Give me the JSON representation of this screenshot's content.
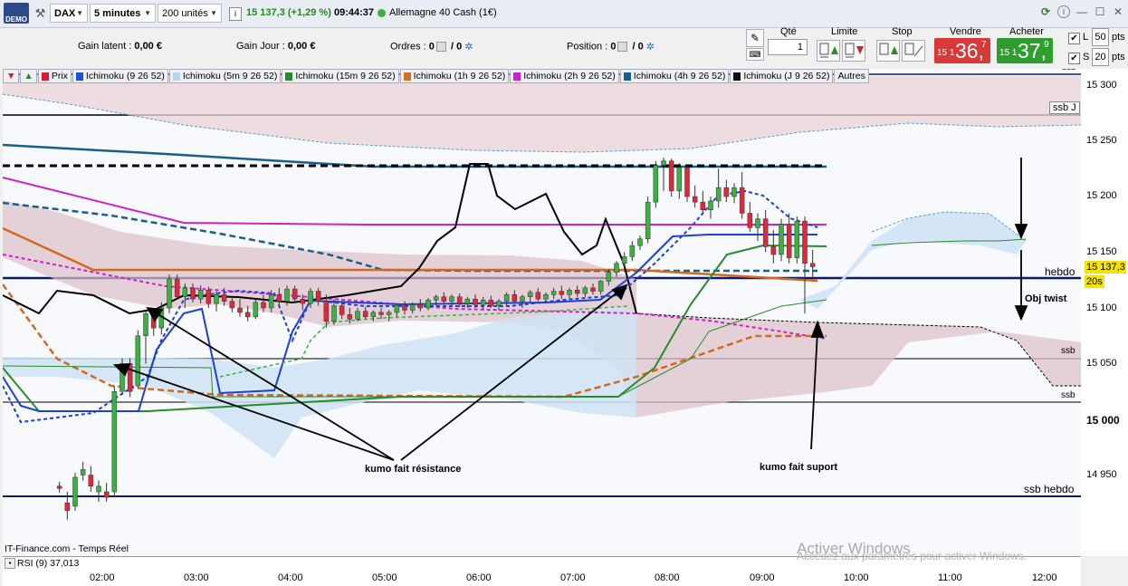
{
  "toolbar": {
    "demo_label": "DEMO",
    "symbol": "DAX",
    "timeframe": "5 minutes",
    "units": "200 unités",
    "price_change": "15 137,3 (+1,29 %)",
    "time": "09:44:37",
    "instrument": "Allemagne 40 Cash (1€)"
  },
  "summary": {
    "gain_latent_label": "Gain latent :",
    "gain_latent_value": "0,00 €",
    "gain_jour_label": "Gain Jour :",
    "gain_jour_value": "0,00 €",
    "ordres_label": "Ordres :",
    "ordres_value": "0",
    "ordres_total": "/ 0",
    "position_label": "Position :",
    "position_value": "0",
    "position_total": "/ 0"
  },
  "order": {
    "qty_label": "Qté",
    "qty_value": "1",
    "limit_label": "Limite",
    "stop_label": "Stop",
    "sell_label": "Vendre",
    "buy_label": "Acheter",
    "sell_small": "15 1",
    "sell_big": "36,",
    "sell_sup": "7",
    "buy_small": "15 1",
    "buy_big": "37,",
    "buy_sup": "9",
    "l_label": "L",
    "l_value": "50",
    "s_label": "S",
    "s_value": "20",
    "pts": "pts"
  },
  "indicators": [
    {
      "label": "Prix",
      "color": "#d81b35"
    },
    {
      "label": "Ichimoku (9 26 52)",
      "color": "#2050d0"
    },
    {
      "label": "Ichimoku (5m 9 26 52)",
      "color": "#b8d4ec"
    },
    {
      "label": "Ichimoku (15m 9 26 52)",
      "color": "#2a8a2a"
    },
    {
      "label": "Ichimoku (1h 9 26 52)",
      "color": "#d07020"
    },
    {
      "label": "Ichimoku (2h 9 26 52)",
      "color": "#cc22cc"
    },
    {
      "label": "Ichimoku (4h 9 26 52)",
      "color": "#1a5e8c"
    },
    {
      "label": "Ichimoku (J 9 26 52)",
      "color": "#111111"
    }
  ],
  "indicators_more": "Autres",
  "y_axis": [
    "15 300",
    "15 250",
    "15 200",
    "15 150",
    "15 100",
    "15 050",
    "15 000",
    "14 950"
  ],
  "price_marker": "15 137,3",
  "countdown": "20s",
  "time_axis": [
    "02:00",
    "03:00",
    "04:00",
    "05:00",
    "06:00",
    "07:00",
    "08:00",
    "09:00",
    "10:00",
    "11:00",
    "12:00"
  ],
  "annotations": {
    "ssb_j": "ssb J",
    "ssb_top": "ssb",
    "hebdo": "hebdo",
    "obj_twist": "Obj twist",
    "ssb_1": "ssb",
    "ssb_2": "ssb",
    "ssb_hebdo": "ssb hebdo",
    "resistance": "kumo fait résistance",
    "support": "kumo fait suport"
  },
  "footer": {
    "source": "IT-Finance.com - Temps Réel",
    "rsi": "RSI (9) 37,013",
    "watermark_1": "Activer Windows",
    "watermark_2": "Accédez aux paramètres pour activer Windows."
  },
  "colors": {
    "bull": "#3cb043",
    "bear": "#e0283c",
    "tenkan": "#1f3fd6",
    "ichi_4h": "#1a5e8c",
    "ichi_2h": "#cc22cc",
    "ichi_1h": "#d2691e",
    "ichi_15m": "#2a8a2a",
    "ichi_j": "#000000",
    "hline": "#0a1a70"
  },
  "chart_data": {
    "type": "candlestick",
    "y_range": [
      14900,
      15315
    ],
    "candles": [
      {
        "t": "01:35",
        "o": 14940,
        "h": 14944,
        "l": 14934,
        "c": 14938
      },
      {
        "t": "01:40",
        "o": 14925,
        "h": 14935,
        "l": 14910,
        "c": 14918
      },
      {
        "t": "01:45",
        "o": 14922,
        "h": 14952,
        "l": 14918,
        "c": 14948
      },
      {
        "t": "01:50",
        "o": 14950,
        "h": 14962,
        "l": 14945,
        "c": 14955
      },
      {
        "t": "01:55",
        "o": 14950,
        "h": 14958,
        "l": 14935,
        "c": 14940
      },
      {
        "t": "02:00",
        "o": 14935,
        "h": 14945,
        "l": 14926,
        "c": 14940
      },
      {
        "t": "02:05",
        "o": 14935,
        "h": 14943,
        "l": 14926,
        "c": 14930
      },
      {
        "t": "02:10",
        "o": 14935,
        "h": 15030,
        "l": 14930,
        "c": 15025
      },
      {
        "t": "02:15",
        "o": 15025,
        "h": 15055,
        "l": 15022,
        "c": 15050
      },
      {
        "t": "02:20",
        "o": 15050,
        "h": 15055,
        "l": 15020,
        "c": 15025
      },
      {
        "t": "02:25",
        "o": 15030,
        "h": 15080,
        "l": 15028,
        "c": 15075
      },
      {
        "t": "02:30",
        "o": 15075,
        "h": 15098,
        "l": 15050,
        "c": 15095
      },
      {
        "t": "02:35",
        "o": 15095,
        "h": 15100,
        "l": 15075,
        "c": 15082
      },
      {
        "t": "02:40",
        "o": 15082,
        "h": 15105,
        "l": 15076,
        "c": 15100
      },
      {
        "t": "02:45",
        "o": 15100,
        "h": 15130,
        "l": 15095,
        "c": 15126
      },
      {
        "t": "02:50",
        "o": 15126,
        "h": 15130,
        "l": 15108,
        "c": 15110
      },
      {
        "t": "02:55",
        "o": 15110,
        "h": 15122,
        "l": 15100,
        "c": 15118
      },
      {
        "t": "03:00",
        "o": 15118,
        "h": 15122,
        "l": 15105,
        "c": 15108
      },
      {
        "t": "03:05",
        "o": 15108,
        "h": 15120,
        "l": 15104,
        "c": 15116
      },
      {
        "t": "03:10",
        "o": 15116,
        "h": 15119,
        "l": 15100,
        "c": 15104
      },
      {
        "t": "03:15",
        "o": 15104,
        "h": 15115,
        "l": 15097,
        "c": 15112
      },
      {
        "t": "03:20",
        "o": 15112,
        "h": 15118,
        "l": 15102,
        "c": 15106
      },
      {
        "t": "03:25",
        "o": 15106,
        "h": 15110,
        "l": 15096,
        "c": 15100
      },
      {
        "t": "03:30",
        "o": 15100,
        "h": 15108,
        "l": 15092,
        "c": 15096
      },
      {
        "t": "03:35",
        "o": 15096,
        "h": 15102,
        "l": 15088,
        "c": 15092
      },
      {
        "t": "03:40",
        "o": 15092,
        "h": 15108,
        "l": 15090,
        "c": 15105
      },
      {
        "t": "03:45",
        "o": 15105,
        "h": 15112,
        "l": 15096,
        "c": 15100
      },
      {
        "t": "03:50",
        "o": 15100,
        "h": 15116,
        "l": 15096,
        "c": 15112
      },
      {
        "t": "03:55",
        "o": 15112,
        "h": 15118,
        "l": 15102,
        "c": 15106
      },
      {
        "t": "04:00",
        "o": 15106,
        "h": 15120,
        "l": 15102,
        "c": 15117
      },
      {
        "t": "04:05",
        "o": 15117,
        "h": 15120,
        "l": 15105,
        "c": 15108
      },
      {
        "t": "04:10",
        "o": 15108,
        "h": 15112,
        "l": 15098,
        "c": 15104
      },
      {
        "t": "04:15",
        "o": 15104,
        "h": 15118,
        "l": 15100,
        "c": 15115
      },
      {
        "t": "04:20",
        "o": 15115,
        "h": 15118,
        "l": 15102,
        "c": 15106
      },
      {
        "t": "04:25",
        "o": 15106,
        "h": 15112,
        "l": 15082,
        "c": 15088
      },
      {
        "t": "04:30",
        "o": 15088,
        "h": 15108,
        "l": 15085,
        "c": 15102
      },
      {
        "t": "04:35",
        "o": 15102,
        "h": 15105,
        "l": 15090,
        "c": 15094
      },
      {
        "t": "04:40",
        "o": 15094,
        "h": 15100,
        "l": 15086,
        "c": 15090
      },
      {
        "t": "04:45",
        "o": 15090,
        "h": 15100,
        "l": 15088,
        "c": 15097
      },
      {
        "t": "04:50",
        "o": 15097,
        "h": 15101,
        "l": 15090,
        "c": 15092
      },
      {
        "t": "04:55",
        "o": 15092,
        "h": 15098,
        "l": 15088,
        "c": 15096
      },
      {
        "t": "05:00",
        "o": 15096,
        "h": 15100,
        "l": 15090,
        "c": 15094
      },
      {
        "t": "05:05",
        "o": 15094,
        "h": 15098,
        "l": 15088,
        "c": 15096
      },
      {
        "t": "05:10",
        "o": 15096,
        "h": 15104,
        "l": 15092,
        "c": 15102
      },
      {
        "t": "05:15",
        "o": 15102,
        "h": 15106,
        "l": 15094,
        "c": 15098
      },
      {
        "t": "05:20",
        "o": 15098,
        "h": 15105,
        "l": 15095,
        "c": 15103
      },
      {
        "t": "05:25",
        "o": 15103,
        "h": 15108,
        "l": 15097,
        "c": 15100
      },
      {
        "t": "05:30",
        "o": 15100,
        "h": 15109,
        "l": 15098,
        "c": 15107
      },
      {
        "t": "05:35",
        "o": 15107,
        "h": 15112,
        "l": 15102,
        "c": 15110
      },
      {
        "t": "05:40",
        "o": 15110,
        "h": 15114,
        "l": 15103,
        "c": 15106
      },
      {
        "t": "05:45",
        "o": 15106,
        "h": 15112,
        "l": 15102,
        "c": 15110
      },
      {
        "t": "05:50",
        "o": 15110,
        "h": 15113,
        "l": 15101,
        "c": 15104
      },
      {
        "t": "05:55",
        "o": 15104,
        "h": 15110,
        "l": 15100,
        "c": 15108
      },
      {
        "t": "06:00",
        "o": 15108,
        "h": 15112,
        "l": 15100,
        "c": 15103
      },
      {
        "t": "06:05",
        "o": 15103,
        "h": 15110,
        "l": 15099,
        "c": 15107
      },
      {
        "t": "06:10",
        "o": 15107,
        "h": 15111,
        "l": 15100,
        "c": 15102
      },
      {
        "t": "06:15",
        "o": 15102,
        "h": 15108,
        "l": 15098,
        "c": 15106
      },
      {
        "t": "06:20",
        "o": 15106,
        "h": 15114,
        "l": 15102,
        "c": 15112
      },
      {
        "t": "06:25",
        "o": 15112,
        "h": 15116,
        "l": 15104,
        "c": 15106
      },
      {
        "t": "06:30",
        "o": 15106,
        "h": 15112,
        "l": 15100,
        "c": 15110
      },
      {
        "t": "06:35",
        "o": 15110,
        "h": 15116,
        "l": 15105,
        "c": 15114
      },
      {
        "t": "06:40",
        "o": 15114,
        "h": 15118,
        "l": 15106,
        "c": 15108
      },
      {
        "t": "06:45",
        "o": 15108,
        "h": 15114,
        "l": 15104,
        "c": 15112
      },
      {
        "t": "06:50",
        "o": 15112,
        "h": 15118,
        "l": 15108,
        "c": 15115
      },
      {
        "t": "06:55",
        "o": 15115,
        "h": 15120,
        "l": 15108,
        "c": 15112
      },
      {
        "t": "07:00",
        "o": 15112,
        "h": 15118,
        "l": 15108,
        "c": 15116
      },
      {
        "t": "07:05",
        "o": 15116,
        "h": 15120,
        "l": 15110,
        "c": 15113
      },
      {
        "t": "07:10",
        "o": 15113,
        "h": 15120,
        "l": 15110,
        "c": 15118
      },
      {
        "t": "07:15",
        "o": 15118,
        "h": 15122,
        "l": 15112,
        "c": 15115
      },
      {
        "t": "07:20",
        "o": 15115,
        "h": 15125,
        "l": 15112,
        "c": 15124
      },
      {
        "t": "07:25",
        "o": 15124,
        "h": 15135,
        "l": 15120,
        "c": 15132
      },
      {
        "t": "07:30",
        "o": 15132,
        "h": 15142,
        "l": 15128,
        "c": 15140
      },
      {
        "t": "07:35",
        "o": 15140,
        "h": 15150,
        "l": 15136,
        "c": 15146
      },
      {
        "t": "07:40",
        "o": 15146,
        "h": 15160,
        "l": 15142,
        "c": 15156
      },
      {
        "t": "07:45",
        "o": 15156,
        "h": 15165,
        "l": 15152,
        "c": 15162
      },
      {
        "t": "07:50",
        "o": 15162,
        "h": 15200,
        "l": 15158,
        "c": 15195
      },
      {
        "t": "07:55",
        "o": 15195,
        "h": 15232,
        "l": 15190,
        "c": 15228
      },
      {
        "t": "08:00",
        "o": 15228,
        "h": 15235,
        "l": 15205,
        "c": 15232
      },
      {
        "t": "08:05",
        "o": 15232,
        "h": 15234,
        "l": 15200,
        "c": 15205
      },
      {
        "t": "08:10",
        "o": 15205,
        "h": 15230,
        "l": 15198,
        "c": 15226
      },
      {
        "t": "08:15",
        "o": 15226,
        "h": 15228,
        "l": 15195,
        "c": 15200
      },
      {
        "t": "08:20",
        "o": 15200,
        "h": 15210,
        "l": 15190,
        "c": 15195
      },
      {
        "t": "08:25",
        "o": 15195,
        "h": 15205,
        "l": 15185,
        "c": 15188
      },
      {
        "t": "08:30",
        "o": 15188,
        "h": 15200,
        "l": 15180,
        "c": 15196
      },
      {
        "t": "08:35",
        "o": 15196,
        "h": 15225,
        "l": 15190,
        "c": 15208
      },
      {
        "t": "08:40",
        "o": 15208,
        "h": 15215,
        "l": 15195,
        "c": 15200
      },
      {
        "t": "08:45",
        "o": 15200,
        "h": 15212,
        "l": 15194,
        "c": 15208
      },
      {
        "t": "08:50",
        "o": 15208,
        "h": 15222,
        "l": 15180,
        "c": 15185
      },
      {
        "t": "08:55",
        "o": 15185,
        "h": 15195,
        "l": 15168,
        "c": 15172
      },
      {
        "t": "09:00",
        "o": 15172,
        "h": 15185,
        "l": 15160,
        "c": 15180
      },
      {
        "t": "09:05",
        "o": 15180,
        "h": 15188,
        "l": 15150,
        "c": 15155
      },
      {
        "t": "09:10",
        "o": 15155,
        "h": 15170,
        "l": 15140,
        "c": 15148
      },
      {
        "t": "09:15",
        "o": 15148,
        "h": 15180,
        "l": 15142,
        "c": 15175
      },
      {
        "t": "09:20",
        "o": 15175,
        "h": 15185,
        "l": 15140,
        "c": 15145
      },
      {
        "t": "09:25",
        "o": 15145,
        "h": 15182,
        "l": 15140,
        "c": 15178
      },
      {
        "t": "09:30",
        "o": 15178,
        "h": 15182,
        "l": 15095,
        "c": 15140
      },
      {
        "t": "09:35",
        "o": 15140,
        "h": 15152,
        "l": 15128,
        "c": 15137
      }
    ]
  }
}
